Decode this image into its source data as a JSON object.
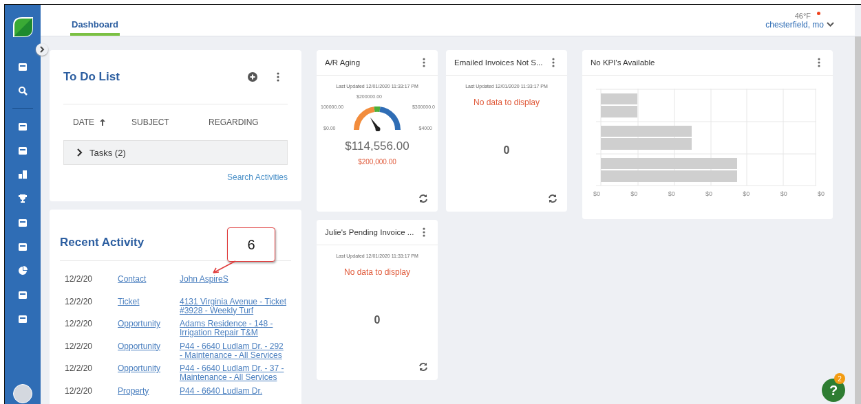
{
  "header": {
    "tabs": [
      {
        "label": "Dashboard",
        "selected": true
      }
    ],
    "weather": {
      "temperature": "46°F",
      "location": "chesterfield, mo"
    }
  },
  "todo": {
    "title": "To Do List",
    "columns": [
      "DATE",
      "SUBJECT",
      "REGARDING"
    ],
    "groups": [
      {
        "label": "Tasks (2)",
        "expanded": false
      }
    ],
    "link": "Search Activities"
  },
  "recent": {
    "title": "Recent Activity",
    "rows": [
      {
        "date": "12/2/20",
        "type": "Contact",
        "regarding": "John AspireS"
      },
      {
        "date": "12/2/20",
        "type": "Ticket",
        "regarding": "4131 Virginia Avenue - Ticket #3928 - Weekly Turf"
      },
      {
        "date": "12/2/20",
        "type": "Opportunity",
        "regarding": "Adams Residence - 148 - Irrigation Repair T&M"
      },
      {
        "date": "12/2/20",
        "type": "Opportunity",
        "regarding": "P44 - 6640 Ludlam Dr. - 292 - Maintenance - All Services"
      },
      {
        "date": "12/2/20",
        "type": "Opportunity",
        "regarding": "P44 - 6640 Ludlam Dr. - 37 - Maintenance - All Services"
      },
      {
        "date": "12/2/20",
        "type": "Property",
        "regarding": "P44 - 6640 Ludlam Dr."
      }
    ],
    "callout": "6"
  },
  "widgets": [
    {
      "kind": "gauge",
      "title": "A/R Aging",
      "updated": "Last Updated 12/01/2020 11:33:17 PM",
      "gauge_labels": [
        "$0.00",
        "100000.00",
        "$200000.00",
        "$300000.0",
        "$4000"
      ],
      "value": "$114,556.00",
      "target": "$200,000.00"
    },
    {
      "kind": "empty",
      "title": "Emailed Invoices Not S...",
      "updated": "Last Updated 12/01/2020 11:33:17 PM",
      "message": "No data to display",
      "value": "0"
    },
    {
      "kind": "empty",
      "title": "Julie's Pending Invoice ...",
      "updated": "Last Updated 12/01/2020 11:33:17 PM",
      "message": "No data to display",
      "value": "0"
    }
  ],
  "kpi": {
    "title": "No KPI's Available",
    "axis_labels": [
      "$0",
      "$0",
      "$0",
      "$0",
      "$0",
      "$0",
      "$0"
    ]
  },
  "help": {
    "label": "?",
    "badge": "2"
  }
}
